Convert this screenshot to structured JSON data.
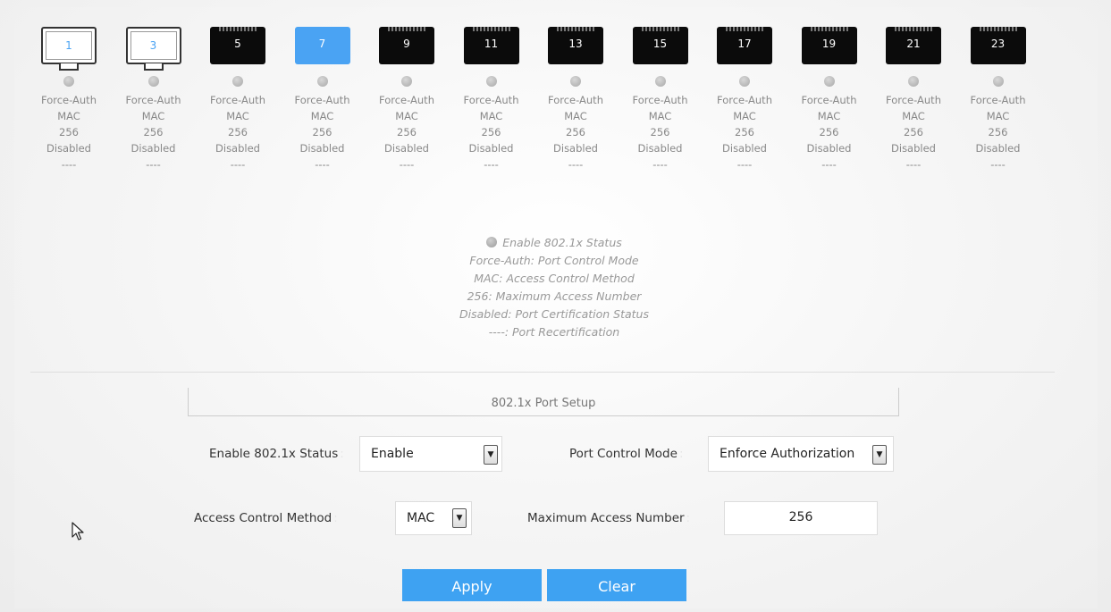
{
  "ports": [
    {
      "number": "1",
      "style": "white",
      "mode": "Force-Auth",
      "method": "MAC",
      "max": "256",
      "status": "Disabled",
      "recert": "----"
    },
    {
      "number": "3",
      "style": "white",
      "mode": "Force-Auth",
      "method": "MAC",
      "max": "256",
      "status": "Disabled",
      "recert": "----"
    },
    {
      "number": "5",
      "style": "black",
      "mode": "Force-Auth",
      "method": "MAC",
      "max": "256",
      "status": "Disabled",
      "recert": "----"
    },
    {
      "number": "7",
      "style": "blue",
      "mode": "Force-Auth",
      "method": "MAC",
      "max": "256",
      "status": "Disabled",
      "recert": "----"
    },
    {
      "number": "9",
      "style": "black",
      "mode": "Force-Auth",
      "method": "MAC",
      "max": "256",
      "status": "Disabled",
      "recert": "----"
    },
    {
      "number": "11",
      "style": "black",
      "mode": "Force-Auth",
      "method": "MAC",
      "max": "256",
      "status": "Disabled",
      "recert": "----"
    },
    {
      "number": "13",
      "style": "black",
      "mode": "Force-Auth",
      "method": "MAC",
      "max": "256",
      "status": "Disabled",
      "recert": "----"
    },
    {
      "number": "15",
      "style": "black",
      "mode": "Force-Auth",
      "method": "MAC",
      "max": "256",
      "status": "Disabled",
      "recert": "----"
    },
    {
      "number": "17",
      "style": "black",
      "mode": "Force-Auth",
      "method": "MAC",
      "max": "256",
      "status": "Disabled",
      "recert": "----"
    },
    {
      "number": "19",
      "style": "black",
      "mode": "Force-Auth",
      "method": "MAC",
      "max": "256",
      "status": "Disabled",
      "recert": "----"
    },
    {
      "number": "21",
      "style": "black",
      "mode": "Force-Auth",
      "method": "MAC",
      "max": "256",
      "status": "Disabled",
      "recert": "----"
    },
    {
      "number": "23",
      "style": "black",
      "mode": "Force-Auth",
      "method": "MAC",
      "max": "256",
      "status": "Disabled",
      "recert": "----"
    }
  ],
  "legend": {
    "status": "Enable 802.1x Status",
    "mode": "Force-Auth: Port Control Mode",
    "method": "MAC: Access Control Method",
    "max": "256: Maximum Access Number",
    "cert": "Disabled: Port Certification Status",
    "recert": "----: Port Recertification"
  },
  "setup": {
    "title": "802.1x Port Setup",
    "enable_label": "Enable 802.1x Status",
    "enable_value": "Enable",
    "control_mode_label": "Port Control Mode",
    "control_mode_value": "Enforce Authorization",
    "access_method_label": "Access Control Method",
    "access_method_value": "MAC",
    "max_access_label": "Maximum Access Number",
    "max_access_value": "256",
    "required_mark": ":"
  },
  "buttons": {
    "apply": "Apply",
    "clear": "Clear"
  },
  "colors": {
    "accent": "#3ea2f2",
    "selected_port": "#4aa3f3",
    "port_black": "#0b0b0b"
  },
  "icons": {
    "dropdown": "▼",
    "cursor": "mouse-pointer-icon"
  }
}
